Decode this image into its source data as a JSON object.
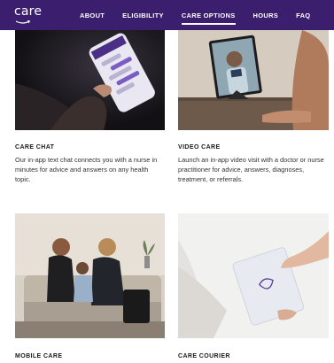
{
  "brand": {
    "logo_text": "care"
  },
  "nav": {
    "items": [
      {
        "label": "ABOUT",
        "active": false
      },
      {
        "label": "ELIGIBILITY",
        "active": false
      },
      {
        "label": "CARE OPTIONS",
        "active": true
      },
      {
        "label": "HOURS",
        "active": false
      },
      {
        "label": "FAQ",
        "active": false
      }
    ]
  },
  "cards": [
    {
      "title": "CARE CHAT",
      "description": "Our in-app text chat connects you with a nurse in minutes for advice and answers on any health topic."
    },
    {
      "title": "VIDEO CARE",
      "description": "Launch an in-app video visit with a doctor or nurse practitioner for advice, answers, diagnoses, treatment, or referrals."
    },
    {
      "title": "MOBILE CARE",
      "description": ""
    },
    {
      "title": "CARE COURIER",
      "description": ""
    }
  ],
  "colors": {
    "nav_background": "#3b1f6e",
    "nav_text": "#ffffff"
  }
}
